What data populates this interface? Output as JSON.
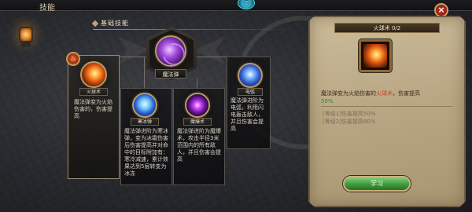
{
  "window": {
    "title": "技能"
  },
  "header": {
    "gem_icon": "spiral-gem-icon",
    "close_label": "×"
  },
  "tree": {
    "section_title": "基础技能",
    "main_skill": {
      "name": "魔法弹",
      "icon": "magic-orb-icon"
    },
    "learn_marker_icon": "flame-badge-icon",
    "branches": [
      {
        "id": "fire",
        "name": "火球术",
        "icon": "fireball-icon",
        "description_parts": [
          "魔法弹变为火焰伤害的",
          "",
          "，伤害提高"
        ],
        "selected": true
      },
      {
        "id": "ice",
        "name": "寒冰弹",
        "icon": "ice-shard-icon",
        "description": "魔法弹进阶为寒冰弹，变为冰霜伤害后伤害提高并对命中的目标附加有：寒冷减速，累计效果达到5层转变为冰冻"
      },
      {
        "id": "void",
        "name": "魔爆术",
        "icon": "void-orb-icon",
        "description": "魔法弹进阶为魔爆术，攻击半径3米范围内的所有敌人，并且伤害会提高"
      },
      {
        "id": "thunder",
        "name": "电弧",
        "icon": "lightning-icon",
        "description": "魔法弹进阶为电弧，利用闪电轰击敌人，并且伤害会提高"
      }
    ]
  },
  "detail": {
    "title": "火球术 0/2",
    "icon": "fireball-icon",
    "desc_prefix": "魔法弹变为火焰伤害的",
    "desc_highlight": "火球术",
    "desc_suffix": "，伤害提高",
    "desc_value": "50%",
    "levels": [
      "[等级1]伤害提高50%",
      "[等级2]伤害提高80%"
    ],
    "learn_button": "学习"
  },
  "colors": {
    "highlight_green": "#3ecf5a",
    "highlight_red": "#c8442a",
    "button_green": "#3f9a3c",
    "parchment": "#c2b18e"
  }
}
